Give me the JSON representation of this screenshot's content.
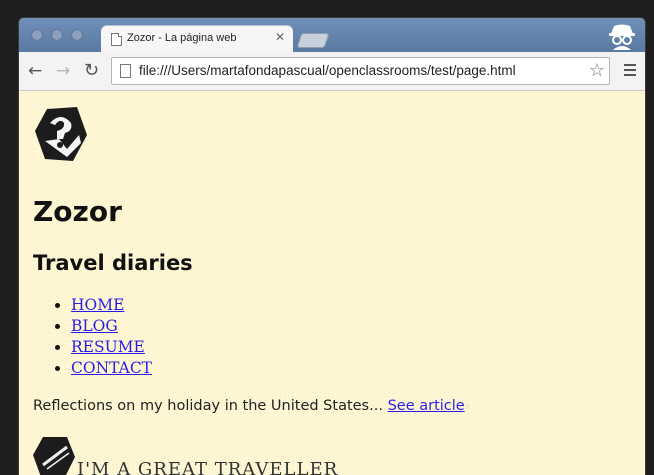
{
  "browser": {
    "tab_title": "Zozor - La página web",
    "tab_close": "✕",
    "url": "file:///Users/martafondapascual/openclassrooms/test/page.html",
    "back_icon": "arrow-left-icon",
    "forward_icon": "arrow-right-icon",
    "reload_icon": "reload-icon",
    "star_icon": "star-icon",
    "menu_icon": "hamburger-menu-icon"
  },
  "page": {
    "site_title": "Zozor",
    "subtitle": "Travel diaries",
    "nav": [
      "HOME",
      "BLOG",
      "RESUME",
      "CONTACT"
    ],
    "article_text": "Reflections on my holiday in the United States...",
    "article_link": "See article",
    "cut_heading": "I'M A GREAT TRAVELLER"
  },
  "colors": {
    "page_background": "#fff6d4",
    "link": "#2a1ee6",
    "tabstrip": "#5b7aa2"
  }
}
